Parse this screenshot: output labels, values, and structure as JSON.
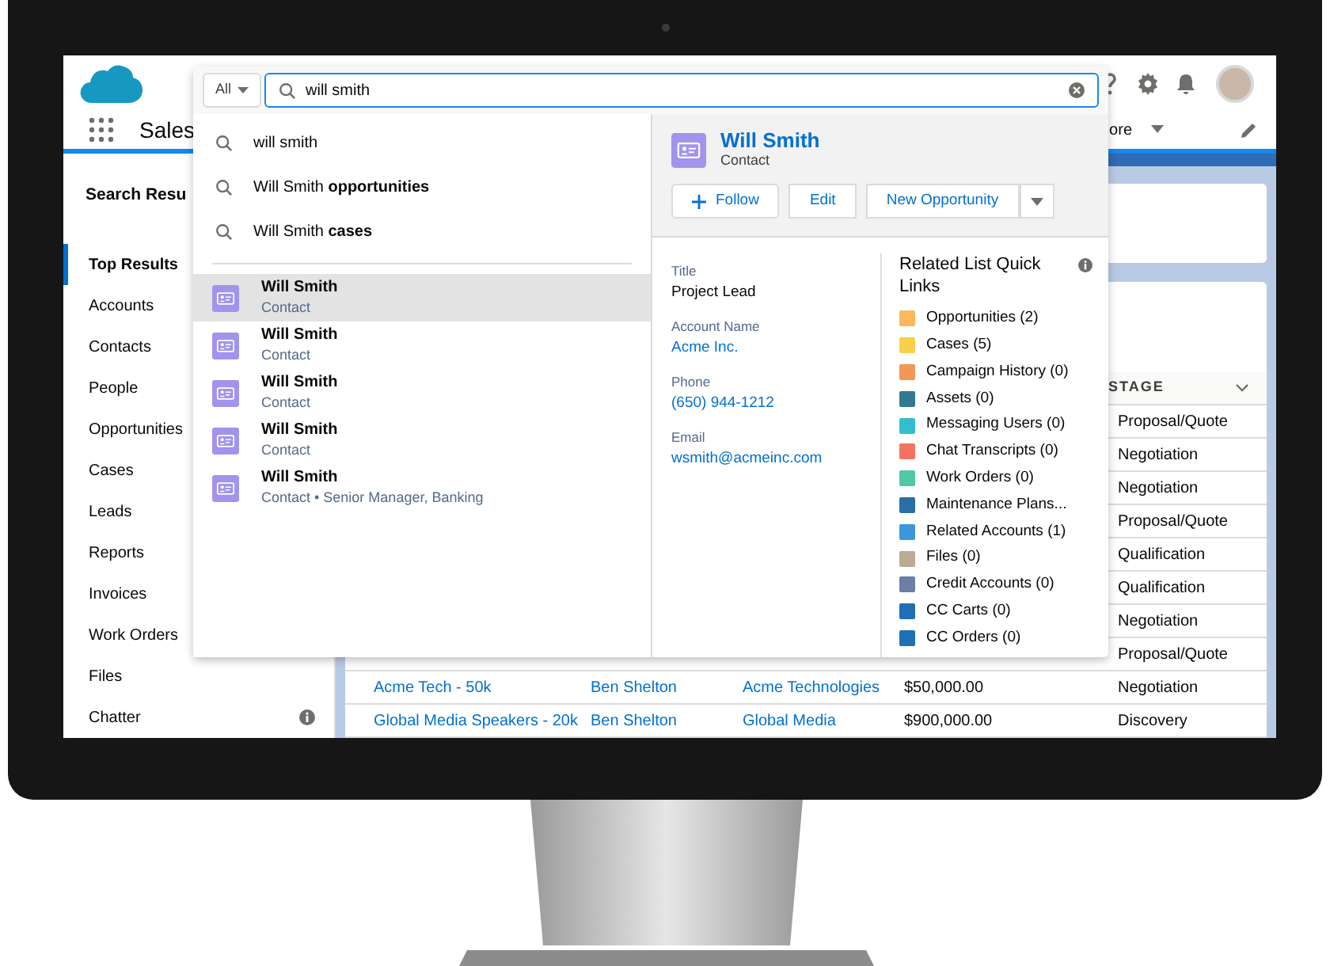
{
  "header": {
    "app_name": "Sales",
    "more_tab": "ore"
  },
  "sidebar": {
    "title": "Search Resu",
    "items": [
      {
        "label": "Top Results",
        "selected": true
      },
      {
        "label": "Accounts",
        "selected": false
      },
      {
        "label": "Contacts",
        "selected": false
      },
      {
        "label": "People",
        "selected": false
      },
      {
        "label": "Opportunities",
        "selected": false
      },
      {
        "label": "Cases",
        "selected": false
      },
      {
        "label": "Leads",
        "selected": false
      },
      {
        "label": "Reports",
        "selected": false
      },
      {
        "label": "Invoices",
        "selected": false
      },
      {
        "label": "Work Orders",
        "selected": false
      },
      {
        "label": "Files",
        "selected": false,
        "info": false
      },
      {
        "label": "Chatter",
        "selected": false,
        "info": true
      }
    ]
  },
  "table": {
    "stage_column": "STAGE",
    "rows": [
      {
        "stage": "Proposal/Quote"
      },
      {
        "stage": "Negotiation"
      },
      {
        "stage": "Negotiation"
      },
      {
        "stage": "Proposal/Quote"
      },
      {
        "stage": "Qualification"
      },
      {
        "stage": "Qualification"
      },
      {
        "stage": "Negotiation"
      },
      {
        "stage": "Proposal/Quote"
      },
      {
        "opportunity": "Acme Tech - 50k",
        "owner": "Ben Shelton",
        "account": "Acme Technologies",
        "amount": "$50,000.00",
        "stage": "Negotiation"
      },
      {
        "opportunity": "Global Media Speakers - 20k",
        "owner": "Ben Shelton",
        "account": "Global Media",
        "amount": "$900,000.00",
        "stage": "Discovery"
      }
    ]
  },
  "search": {
    "scope": "All",
    "query": "will smith",
    "suggestions": [
      {
        "text": "will smith"
      },
      {
        "text": "Will Smith **opportunities**"
      },
      {
        "text": "Will Smith **cases**"
      }
    ],
    "results": [
      {
        "name": "Will Smith",
        "subtitle": "Contact",
        "selected": true
      },
      {
        "name": "Will Smith",
        "subtitle": "Contact",
        "selected": false
      },
      {
        "name": "Will Smith",
        "subtitle": "Contact",
        "selected": false
      },
      {
        "name": "Will Smith",
        "subtitle": "Contact",
        "selected": false
      },
      {
        "name": "Will Smith",
        "subtitle": "Contact • Senior Manager, Banking",
        "selected": false
      }
    ]
  },
  "preview": {
    "name": "Will Smith",
    "type": "Contact",
    "buttons": [
      "Follow",
      "Edit",
      "New Opportunity"
    ],
    "fields": [
      {
        "label": "Title",
        "value": "Project Lead",
        "link": false
      },
      {
        "label": "Account Name",
        "value": "Acme Inc.",
        "link": true
      },
      {
        "label": "Phone",
        "value": "(650) 944-1212",
        "link": true
      },
      {
        "label": "Email",
        "value": "wsmith@acmeinc.com",
        "link": true
      }
    ],
    "related": {
      "title": "Related List Quick Links",
      "items": [
        {
          "label": "Opportunities (2)",
          "color": "#fcb95b"
        },
        {
          "label": "Cases (5)",
          "color": "#f7d04c"
        },
        {
          "label": "Campaign History (0)",
          "color": "#f49756"
        },
        {
          "label": "Assets (0)",
          "color": "#317992"
        },
        {
          "label": "Messaging Users (0)",
          "color": "#34becd"
        },
        {
          "label": "Chat Transcripts (0)",
          "color": "#f2745f"
        },
        {
          "label": "Work Orders (0)",
          "color": "#50c8a8"
        },
        {
          "label": "Maintenance Plans...",
          "color": "#2a6fa8"
        },
        {
          "label": "Related Accounts (1)",
          "color": "#3c97dd"
        },
        {
          "label": "Files (0)",
          "color": "#baac93"
        },
        {
          "label": "Credit Accounts (0)",
          "color": "#6b7ea3"
        },
        {
          "label": "CC Carts (0)",
          "color": "#1f6fb5"
        },
        {
          "label": "CC Orders (0)",
          "color": "#1f6fb5"
        }
      ]
    }
  }
}
